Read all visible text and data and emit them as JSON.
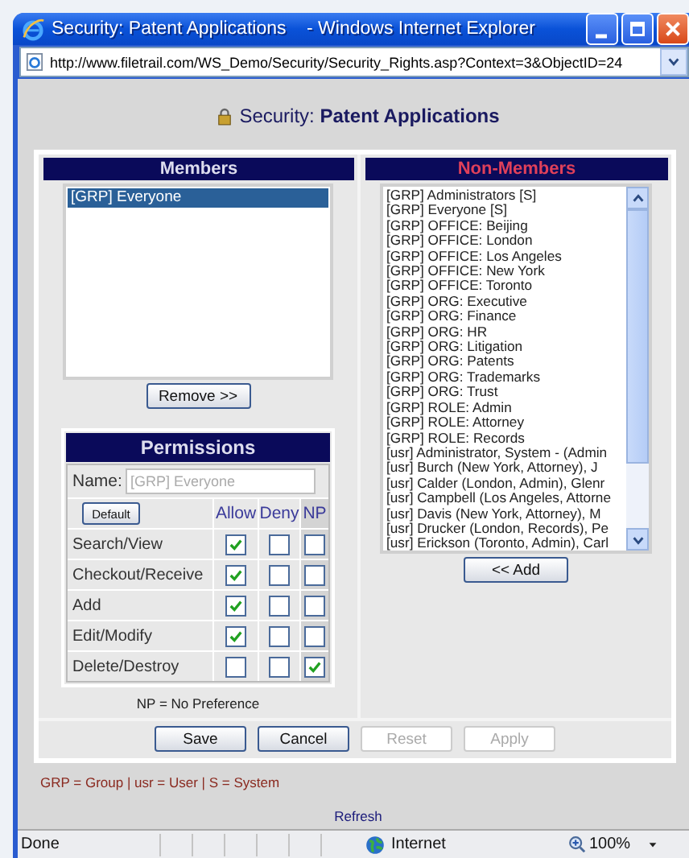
{
  "window": {
    "title": "Security: Patent Applications    - Windows Internet Explorer"
  },
  "address_bar": {
    "url": "http://www.filetrail.com/WS_Demo/Security/Security_Rights.asp?Context=3&ObjectID=24"
  },
  "heading": "Security: **Patent Applications**",
  "members": {
    "header": "Members",
    "items": [
      {
        "label": "[GRP] Everyone",
        "selected": true
      }
    ],
    "remove_button": "Remove >>"
  },
  "permissions": {
    "header": "Permissions",
    "name_label": "Name:",
    "name_value": "[GRP] Everyone",
    "default_button": "Default",
    "columns": [
      "Allow",
      "Deny",
      "NP"
    ],
    "rows": [
      {
        "label": "Search/View",
        "allow": true,
        "deny": false,
        "np": false
      },
      {
        "label": "Checkout/Receive",
        "allow": true,
        "deny": false,
        "np": false
      },
      {
        "label": "Add",
        "allow": true,
        "deny": false,
        "np": false
      },
      {
        "label": "Edit/Modify",
        "allow": true,
        "deny": false,
        "np": false
      },
      {
        "label": "Delete/Destroy",
        "allow": false,
        "deny": false,
        "np": true
      }
    ],
    "note": "NP = No Preference"
  },
  "non_members": {
    "header": "Non-Members",
    "items": [
      {
        "label": "[GRP] Administrators [S]",
        "selected": false
      },
      {
        "label": "[GRP] Everyone [S]",
        "selected": false
      },
      {
        "label": "[GRP] OFFICE: Beijing",
        "selected": false
      },
      {
        "label": "[GRP] OFFICE: London",
        "selected": false
      },
      {
        "label": "[GRP] OFFICE: Los Angeles",
        "selected": false
      },
      {
        "label": "[GRP] OFFICE: New York",
        "selected": false
      },
      {
        "label": "[GRP] OFFICE: Toronto",
        "selected": false
      },
      {
        "label": "[GRP] ORG: Executive",
        "selected": false
      },
      {
        "label": "[GRP] ORG: Finance",
        "selected": false
      },
      {
        "label": "[GRP] ORG: HR",
        "selected": false
      },
      {
        "label": "[GRP] ORG: Litigation",
        "selected": false
      },
      {
        "label": "[GRP] ORG: Patents",
        "selected": false
      },
      {
        "label": "[GRP] ORG: Trademarks",
        "selected": false
      },
      {
        "label": "[GRP] ORG: Trust",
        "selected": false
      },
      {
        "label": "[GRP] ROLE: Admin",
        "selected": false
      },
      {
        "label": "[GRP] ROLE: Attorney",
        "selected": false
      },
      {
        "label": "[GRP] ROLE: Records",
        "selected": false
      },
      {
        "label": "[usr] Administrator, System - (Admin",
        "selected": false
      },
      {
        "label": "[usr] Burch (New York, Attorney), J",
        "selected": false
      },
      {
        "label": "[usr] Calder (London, Admin), Glenr",
        "selected": false
      },
      {
        "label": "[usr] Campbell (Los Angeles, Attorne",
        "selected": false
      },
      {
        "label": "[usr] Davis (New York, Attorney), M",
        "selected": false
      },
      {
        "label": "[usr] Drucker (London, Records), Pe",
        "selected": false
      },
      {
        "label": "[usr] Erickson (Toronto, Admin), Carl",
        "selected": false
      }
    ],
    "add_button": "<< Add"
  },
  "buttons": [
    {
      "label": "Save",
      "disabled": false
    },
    {
      "label": "Cancel",
      "disabled": false
    },
    {
      "label": "Reset",
      "disabled": true
    },
    {
      "label": "Apply",
      "disabled": true
    }
  ],
  "legend": "GRP = Group | usr = User | S = System",
  "refresh_link": "Refresh",
  "status_bar": {
    "status": "Done",
    "zone": "Internet",
    "zoom": "100%"
  }
}
